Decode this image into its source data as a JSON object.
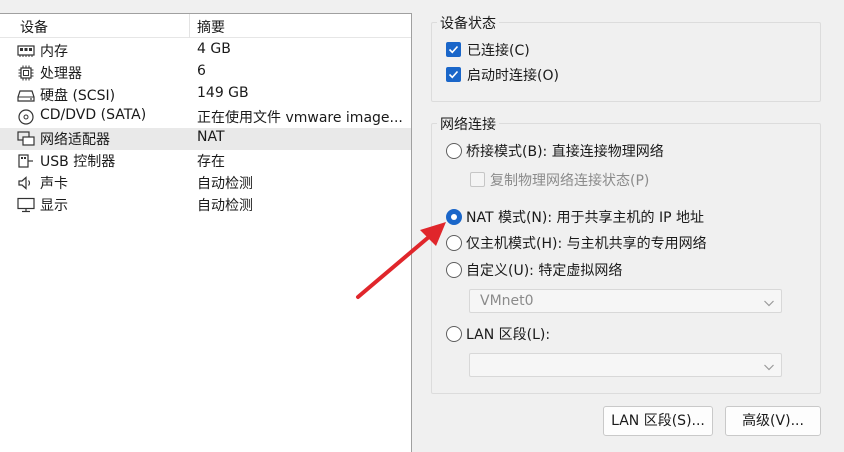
{
  "device_list": {
    "header": {
      "device": "设备",
      "summary": "摘要"
    },
    "rows": [
      {
        "name": "内存",
        "summary": "4 GB",
        "icon": "memory-icon"
      },
      {
        "name": "处理器",
        "summary": "6",
        "icon": "processor-icon"
      },
      {
        "name": "硬盘 (SCSI)",
        "summary": "149 GB",
        "icon": "hard-disk-icon"
      },
      {
        "name": "CD/DVD (SATA)",
        "summary": "正在使用文件 vmware image...",
        "icon": "cd-dvd-icon"
      },
      {
        "name": "网络适配器",
        "summary": "NAT",
        "icon": "network-adapter-icon",
        "selected": true
      },
      {
        "name": "USB 控制器",
        "summary": "存在",
        "icon": "usb-icon"
      },
      {
        "name": "声卡",
        "summary": "自动检测",
        "icon": "speaker-icon"
      },
      {
        "name": "显示",
        "summary": "自动检测",
        "icon": "monitor-icon"
      }
    ]
  },
  "device_status": {
    "title": "设备状态",
    "connected": {
      "label": "已连接(C)",
      "checked": true
    },
    "connect_at_power_on": {
      "label": "启动时连接(O)",
      "checked": true
    }
  },
  "network_connection": {
    "title": "网络连接",
    "bridged": {
      "label": "桥接模式(B): 直接连接物理网络",
      "checked": false
    },
    "replicate_state": {
      "label": "复制物理网络连接状态(P)",
      "checked": false,
      "disabled": true
    },
    "nat": {
      "label": "NAT 模式(N): 用于共享主机的 IP 地址",
      "checked": true
    },
    "host_only": {
      "label": "仅主机模式(H): 与主机共享的专用网络",
      "checked": false
    },
    "custom": {
      "label": "自定义(U): 特定虚拟网络",
      "checked": false
    },
    "custom_select_value": "VMnet0",
    "lan_segment": {
      "label": "LAN 区段(L):",
      "checked": false
    },
    "lan_select_value": ""
  },
  "buttons": {
    "lan_segments": "LAN 区段(S)...",
    "advanced": "高级(V)..."
  },
  "colors": {
    "accent": "#1a66c9",
    "annotation_arrow": "#e0262b",
    "selected_row": "#e9e9e9"
  }
}
